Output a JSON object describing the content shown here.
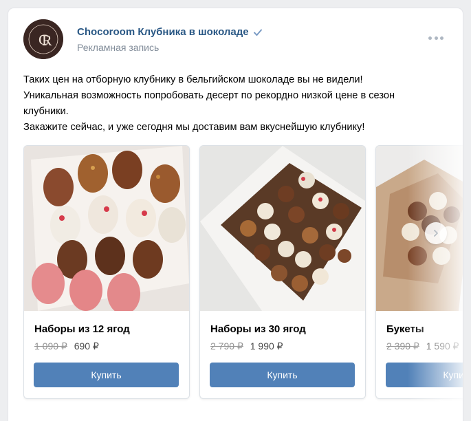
{
  "post": {
    "author": "Chocoroom Клубника в шоколаде",
    "subtitle": "Рекламная запись",
    "text_lines": [
      "Таких цен на отборную клубнику в бельгийском шоколаде вы не видели!",
      "Уникальная возможность попробовать десерт по рекордно низкой цене в сезон",
      "клубники.",
      "Закажите сейчас, и уже сегодня мы доставим вам вкуснейшую клубнику!"
    ]
  },
  "cards": [
    {
      "title": "Наборы из 12 ягод",
      "old_price": "1 090 ₽",
      "new_price": "690 ₽",
      "button": "Купить"
    },
    {
      "title": "Наборы из 30 ягод",
      "old_price": "2 790 ₽",
      "new_price": "1 990 ₽",
      "button": "Купить"
    },
    {
      "title": "Букеты",
      "old_price": "2 390 ₽",
      "new_price": "1 590 ₽",
      "button": "Купить"
    }
  ],
  "colors": {
    "link": "#2a5885",
    "button": "#5181b8",
    "meta": "#818c99"
  },
  "icons": {
    "verified": "check-icon",
    "more": "more-dots-icon",
    "next": "chevron-right-icon"
  }
}
